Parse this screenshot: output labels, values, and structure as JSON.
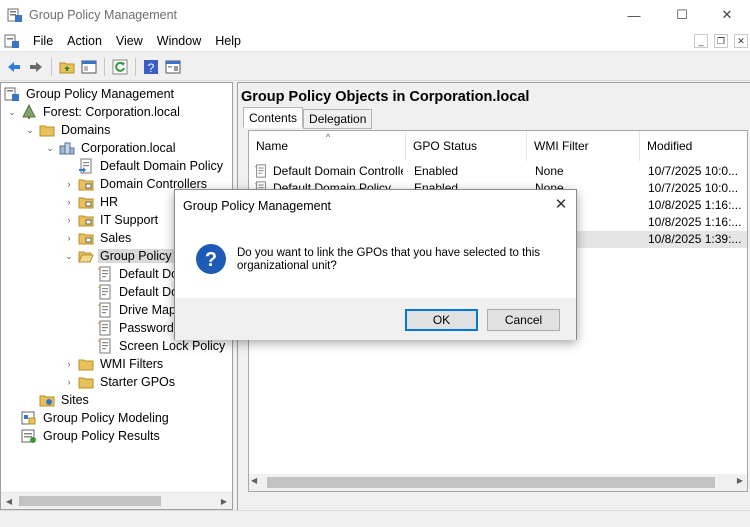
{
  "window": {
    "title": "Group Policy Management",
    "controls": [
      "—",
      "☐",
      "✕"
    ]
  },
  "menu": {
    "items": [
      "File",
      "Action",
      "View",
      "Window",
      "Help"
    ]
  },
  "tree": {
    "items": [
      {
        "label": "Group Policy Management",
        "level": 0,
        "twisty": "",
        "icon": "gpm-console-icon"
      },
      {
        "label": "Forest: Corporation.local",
        "level": 1,
        "twisty": "⌄",
        "icon": "forest-icon"
      },
      {
        "label": "Domains",
        "level": 2,
        "twisty": "⌄",
        "icon": "folder-icon"
      },
      {
        "label": "Corporation.local",
        "level": 3,
        "twisty": "⌄",
        "icon": "domain-icon"
      },
      {
        "label": "Default Domain Policy",
        "level": 4,
        "twisty": "",
        "icon": "gpo-link-icon"
      },
      {
        "label": "Domain Controllers",
        "level": 4,
        "twisty": "›",
        "icon": "ou-folder-icon"
      },
      {
        "label": "HR",
        "level": 4,
        "twisty": "›",
        "icon": "ou-folder-icon"
      },
      {
        "label": "IT Support",
        "level": 4,
        "twisty": "›",
        "icon": "ou-folder-icon"
      },
      {
        "label": "Sales",
        "level": 4,
        "twisty": "›",
        "icon": "ou-folder-icon"
      },
      {
        "label": "Group Policy Objects",
        "level": 4,
        "twisty": "⌄",
        "icon": "folder-open-icon",
        "selected": true
      },
      {
        "label": "Default Domain Controllers Policy",
        "level": 5,
        "twisty": "",
        "icon": "gpo-icon"
      },
      {
        "label": "Default Domain Policy",
        "level": 5,
        "twisty": "",
        "icon": "gpo-icon"
      },
      {
        "label": "Drive Mappings",
        "level": 5,
        "twisty": "",
        "icon": "gpo-icon"
      },
      {
        "label": "Password Policy",
        "level": 5,
        "twisty": "",
        "icon": "gpo-icon"
      },
      {
        "label": "Screen Lock Policy",
        "level": 5,
        "twisty": "",
        "icon": "gpo-icon"
      },
      {
        "label": "WMI Filters",
        "level": 4,
        "twisty": "›",
        "icon": "folder-icon"
      },
      {
        "label": "Starter GPOs",
        "level": 4,
        "twisty": "›",
        "icon": "folder-icon"
      },
      {
        "label": "Sites",
        "level": 2,
        "twisty": "",
        "icon": "sites-icon"
      },
      {
        "label": "Group Policy Modeling",
        "level": 1,
        "twisty": "",
        "icon": "modeling-icon"
      },
      {
        "label": "Group Policy Results",
        "level": 1,
        "twisty": "",
        "icon": "results-icon"
      }
    ]
  },
  "content": {
    "title": "Group Policy Objects in Corporation.local",
    "tabs": [
      "Contents",
      "Delegation"
    ],
    "active_tab": "Contents",
    "columns": [
      "Name",
      "GPO Status",
      "WMI Filter",
      "Modified"
    ],
    "rows": [
      {
        "name": "Default Domain Controller...",
        "status": "Enabled",
        "wmi": "None",
        "modified": "10/7/2025 10:0..."
      },
      {
        "name": "Default Domain Policy",
        "status": "Enabled",
        "wmi": "None",
        "modified": "10/7/2025 10:0..."
      },
      {
        "name": "",
        "status": "",
        "wmi": "",
        "modified": "10/8/2025 1:16:..."
      },
      {
        "name": "",
        "status": "",
        "wmi": "",
        "modified": "10/8/2025 1:16:..."
      },
      {
        "name": "",
        "status": "",
        "wmi": "",
        "modified": "10/8/2025 1:39:...",
        "highlighted": true
      }
    ]
  },
  "dialog": {
    "title": "Group Policy Management",
    "message": "Do you want to link the GPOs that you have selected to this organizational unit?",
    "ok_label": "OK",
    "cancel_label": "Cancel",
    "icon": "question-icon"
  },
  "colors": {
    "accent": "#0078d7",
    "question_icon": "#1e5bb7",
    "folder": "#e8c15a"
  }
}
